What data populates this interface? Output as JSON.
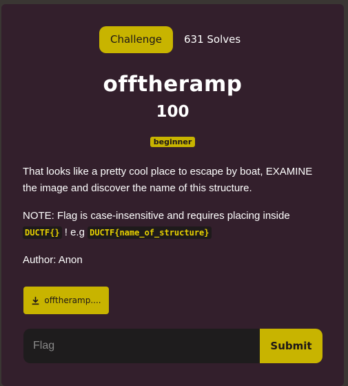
{
  "tabs": {
    "challenge_label": "Challenge",
    "solves_label": "631 Solves"
  },
  "challenge": {
    "name": "offtheramp",
    "points": "100",
    "tag": "beginner"
  },
  "description": {
    "paragraph1": "That looks like a pretty cool place to escape by boat, EXAMINE the image and discover the name of this structure.",
    "note_prefix": "NOTE: Flag is case-insensitive and requires placing inside ",
    "note_code1": "DUCTF{}",
    "note_middle": " ! e.g ",
    "note_code2": "DUCTF{name_of_structure}",
    "author": "Author: Anon"
  },
  "file": {
    "label": "offtheramp....",
    "icon": "download-icon"
  },
  "flag_form": {
    "placeholder": "Flag",
    "submit_label": "Submit"
  },
  "colors": {
    "accent": "#c8b400",
    "modal_bg": "#331f2c"
  }
}
